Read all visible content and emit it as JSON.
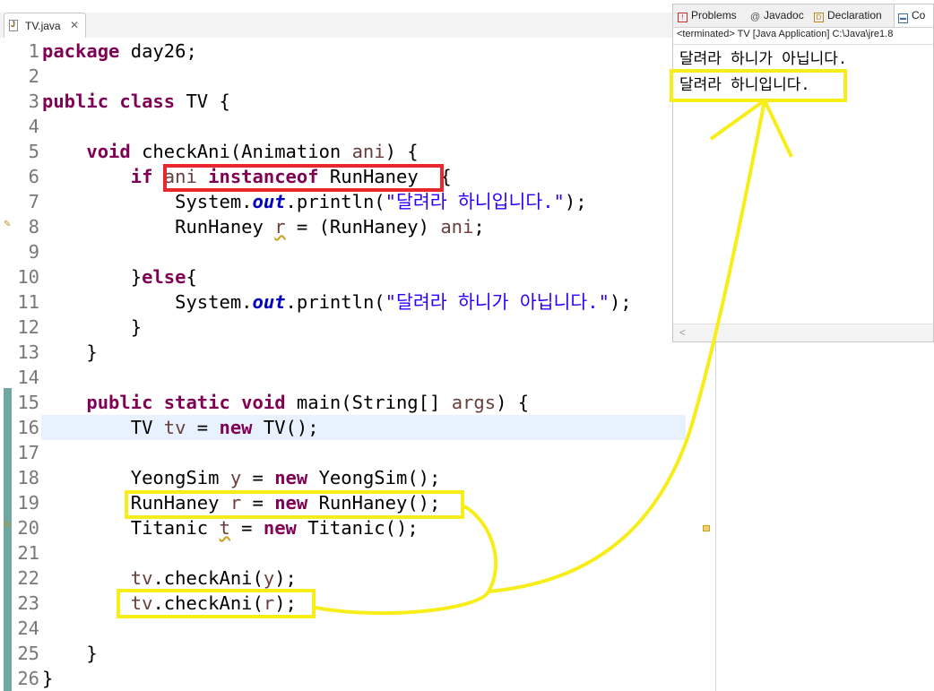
{
  "editor": {
    "tab_label": "TV.java",
    "tab_close": "✕",
    "lines": [
      {
        "n": "1"
      },
      {
        "n": "2"
      },
      {
        "n": "3"
      },
      {
        "n": "4"
      },
      {
        "n": "5"
      },
      {
        "n": "6"
      },
      {
        "n": "7"
      },
      {
        "n": "8"
      },
      {
        "n": "9"
      },
      {
        "n": "10"
      },
      {
        "n": "11"
      },
      {
        "n": "12"
      },
      {
        "n": "13"
      },
      {
        "n": "14"
      },
      {
        "n": "15"
      },
      {
        "n": "16"
      },
      {
        "n": "17"
      },
      {
        "n": "18"
      },
      {
        "n": "19"
      },
      {
        "n": "20"
      },
      {
        "n": "21"
      },
      {
        "n": "22"
      },
      {
        "n": "23"
      },
      {
        "n": "24"
      },
      {
        "n": "25"
      },
      {
        "n": "26"
      }
    ],
    "code": {
      "l1_kw": "package",
      "l1_rest": " day26;",
      "l3_kw": "public class",
      "l3_rest": " TV {",
      "l5_kw": "void",
      "l5_a": " checkAni(Animation ",
      "l5_var": "ani",
      "l5_b": ") {",
      "l6_kw": "if",
      "l6_var": "ani",
      "l6_kw2": "instanceof",
      "l6_rest": " RunHaney ",
      "l6_end": " {",
      "l7_a": "System.",
      "l7_fld": "out",
      "l7_b": ".println(",
      "l7_str": "\"달려라 하니입니다.\"",
      "l7_c": ");",
      "l8_a": "RunHaney ",
      "l8_var": "r",
      "l8_b": " = (RunHaney) ",
      "l8_var2": "ani",
      "l8_c": ";",
      "l10_a": "}",
      "l10_kw": "else",
      "l10_b": "{",
      "l11_a": "System.",
      "l11_fld": "out",
      "l11_b": ".println(",
      "l11_str": "\"달려라 하니가 아닙니다.\"",
      "l11_c": ");",
      "l12": "}",
      "l13": "}",
      "l15_kw": "public static void",
      "l15_a": " main(String[] ",
      "l15_var": "args",
      "l15_b": ") {",
      "l16_a": "TV ",
      "l16_var": "tv",
      "l16_b": " = ",
      "l16_kw": "new",
      "l16_c": " TV();",
      "l18_a": "YeongSim ",
      "l18_var": "y",
      "l18_b": " = ",
      "l18_kw": "new",
      "l18_c": " YeongSim();",
      "l19_a": "RunHaney ",
      "l19_var": "r",
      "l19_b": " = ",
      "l19_kw": "new",
      "l19_c": " RunHaney();",
      "l20_a": "Titanic ",
      "l20_var": "t",
      "l20_b": " = ",
      "l20_kw": "new",
      "l20_c": " Titanic();",
      "l22_var": "tv",
      "l22_a": ".checkAni(",
      "l22_var2": "y",
      "l22_b": ");",
      "l23_var": "tv",
      "l23_a": ".checkAni(",
      "l23_var2": "r",
      "l23_b": ");",
      "l25": "}",
      "l26": "}"
    }
  },
  "console": {
    "tabs": [
      {
        "label": "Problems",
        "icon": "problems-icon"
      },
      {
        "label": "Javadoc",
        "icon": "javadoc-icon"
      },
      {
        "label": "Declaration",
        "icon": "declaration-icon"
      },
      {
        "label": "Co",
        "icon": "console-icon"
      }
    ],
    "status": "<terminated> TV [Java Application] C:\\Java\\jre1.8",
    "output": [
      "달려라 하니가 아닙니다.",
      "달려라 하니입니다."
    ]
  },
  "annotation_colors": {
    "red": "#e8282a",
    "yellow": "#f7ee19"
  }
}
